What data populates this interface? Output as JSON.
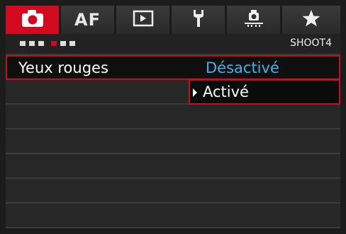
{
  "tabs": [
    {
      "name": "shooting",
      "label": "",
      "active": true
    },
    {
      "name": "af",
      "label": "AF",
      "active": false
    },
    {
      "name": "playback",
      "label": "",
      "active": false
    },
    {
      "name": "setup",
      "label": "",
      "active": false
    },
    {
      "name": "custom",
      "label": "",
      "active": false
    },
    {
      "name": "mymenu",
      "label": "",
      "active": false
    }
  ],
  "subbar": {
    "page_code": "SHOOT4",
    "dots_total": 6,
    "active_dot_index": 3
  },
  "menu": {
    "items": [
      {
        "label": "Yeux rouges",
        "value": "Désactivé",
        "selected": true
      }
    ],
    "empty_rows": 6
  },
  "dropdown": {
    "options": [
      "Activé"
    ]
  },
  "colors": {
    "accent_red": "#d10a1f",
    "value_blue": "#3fb6e6"
  }
}
